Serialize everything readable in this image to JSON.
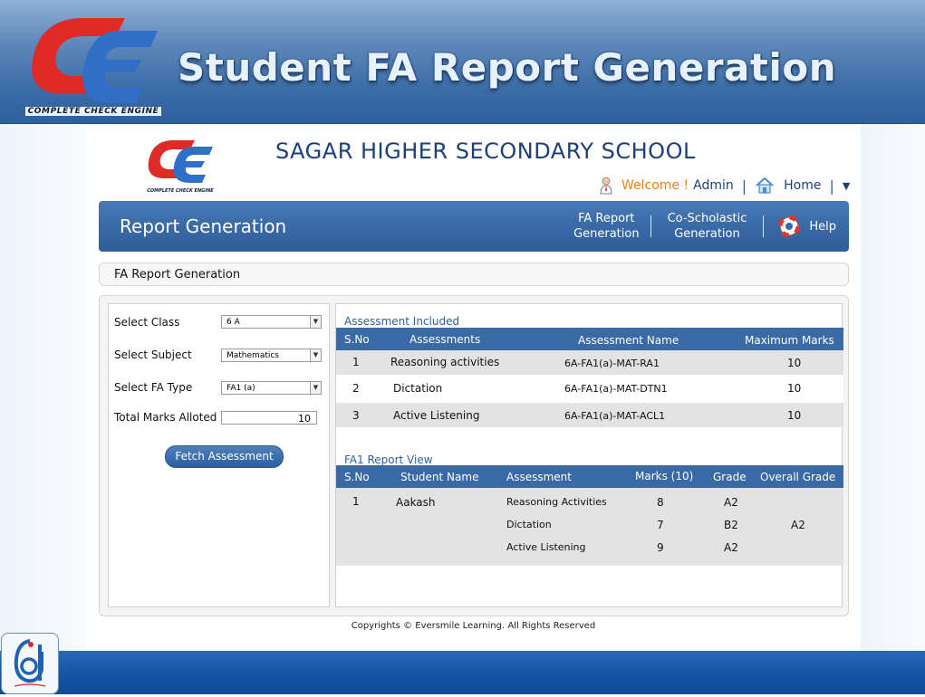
{
  "slide": {
    "title": "Student FA Report Generation",
    "logo_caption": "COMPLETE CHECK ENGINE"
  },
  "school": {
    "name": "SAGAR HIGHER SECONDARY SCHOOL",
    "logo_caption": "COMPLETE CHECK ENGINE"
  },
  "userbar": {
    "welcome": "Welcome !",
    "user": "Admin",
    "home": "Home"
  },
  "header": {
    "title": "Report Generation",
    "nav": [
      {
        "line1": "FA Report",
        "line2": "Generation"
      },
      {
        "line1": "Co-Scholastic",
        "line2": "Generation"
      }
    ],
    "help": "Help"
  },
  "breadcrumb": "FA Report Generation",
  "form": {
    "class_label": "Select Class",
    "class_value": "6 A",
    "subject_label": "Select Subject",
    "subject_value": "Mathematics",
    "fa_label": "Select FA Type",
    "fa_value": "FA1 (a)",
    "marks_label": "Total Marks Alloted :",
    "marks_value": "10",
    "fetch_button": "Fetch Assessment"
  },
  "assessments": {
    "title": "Assessment Included",
    "headers": [
      "S.No",
      "Assessments",
      "Assessment Name",
      "Maximum Marks"
    ],
    "rows": [
      [
        "1",
        "Reasoning activities",
        "6A-FA1(a)-MAT-RA1",
        "10"
      ],
      [
        "2",
        "Dictation",
        "6A-FA1(a)-MAT-DTN1",
        "10"
      ],
      [
        "3",
        "Active Listening",
        "6A-FA1(a)-MAT-ACL1",
        "10"
      ]
    ]
  },
  "report": {
    "title": "FA1 Report View",
    "headers": [
      "S.No",
      "Student Name",
      "Assessment",
      "Marks (10)",
      "Grade",
      "Overall Grade"
    ],
    "student_sno": "1",
    "student_name": "Aakash",
    "overall_grade": "A2",
    "rows": [
      {
        "assessment": "Reasoning Activities",
        "marks": "8",
        "grade": "A2"
      },
      {
        "assessment": "Dictation",
        "marks": "7",
        "grade": "B2"
      },
      {
        "assessment": "Active Listening",
        "marks": "9",
        "grade": "A2"
      }
    ]
  },
  "footer": "Copyrights © Eversmile Learning. All Rights Reserved",
  "colors": {
    "primary_blue": "#3a6aa6",
    "title_blue": "#1d3f7a",
    "welcome_orange": "#e8830c",
    "logo_red": "#e02a25",
    "logo_blue": "#2f6fc8"
  }
}
